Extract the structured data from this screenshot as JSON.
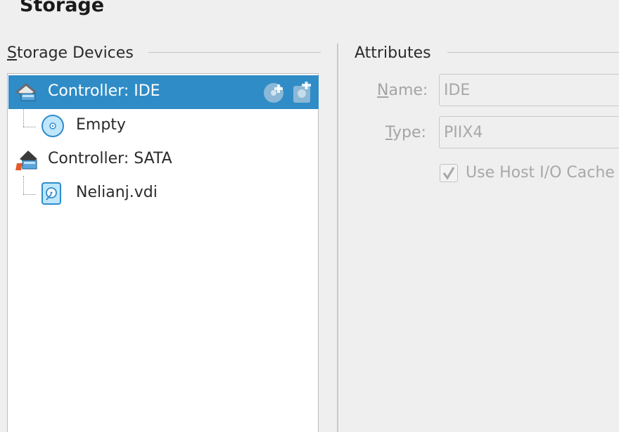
{
  "page": {
    "title": "Storage"
  },
  "storage_devices": {
    "title": "Storage Devices",
    "mnemonic": "S",
    "title_rest": "torage Devices",
    "items": [
      {
        "label": "Controller: IDE",
        "icon": "ide-controller-icon",
        "selected": true
      },
      {
        "label": "Empty",
        "icon": "optical-disc-icon",
        "selected": false
      },
      {
        "label": "Controller: SATA",
        "icon": "sata-controller-icon",
        "selected": false
      },
      {
        "label": "Nelianj.vdi",
        "icon": "hard-disk-icon",
        "selected": false
      }
    ],
    "controller_actions": {
      "add_optical": "add-optical-drive-icon",
      "add_hard_disk": "add-hard-disk-icon"
    }
  },
  "attributes": {
    "title": "Attributes",
    "name_label": "Name:",
    "name_mnemonic": "N",
    "name_label_rest": "ame:",
    "name_value": "IDE",
    "type_label": "Type:",
    "type_mnemonic": "T",
    "type_label_rest": "ype:",
    "type_value": "PIIX4",
    "host_io_cache_label": "Use Host I/O Cache",
    "host_io_cache_checked": true
  },
  "colors": {
    "selection": "#308cc6",
    "window_bg": "#efefef",
    "disabled_text": "#a4a4a4"
  }
}
